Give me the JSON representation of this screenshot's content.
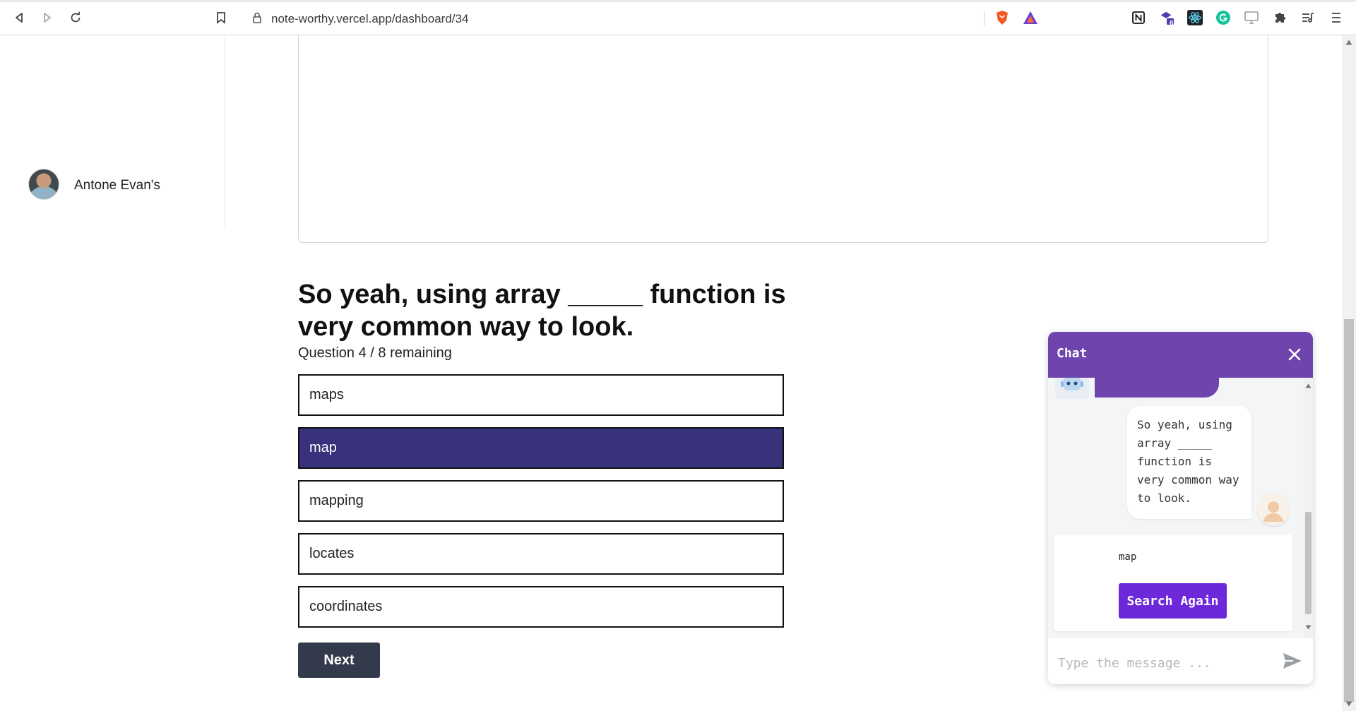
{
  "browser": {
    "url": "note-worthy.vercel.app/dashboard/34",
    "extensions": [
      "brave-shield-icon",
      "brave-rewards-icon",
      "notion-icon",
      "extension-badge-icon",
      "react-devtools-icon",
      "grammarly-icon",
      "screen-icon",
      "puzzle-icon",
      "reading-list-icon",
      "menu-icon"
    ],
    "extension_badge": "6"
  },
  "sidebar": {
    "user_name": "Antone Evan's"
  },
  "quiz": {
    "question": "So yeah, using array _____ function is very common way to look.",
    "progress": "Question 4 / 8 remaining",
    "options": [
      "maps",
      "map",
      "mapping",
      "locates",
      "coordinates"
    ],
    "selected_index": 1,
    "next_label": "Next"
  },
  "chat": {
    "title": "Chat",
    "user_message": "So yeah, using array _____ function is very common way to look.",
    "answer": "map",
    "search_again_label": "Search Again",
    "input_placeholder": "Type the message ..."
  },
  "colors": {
    "selected_option": "#38327c",
    "chat_header": "#6f45ad",
    "search_button": "#6d28d9",
    "next_button": "#323a4b"
  }
}
